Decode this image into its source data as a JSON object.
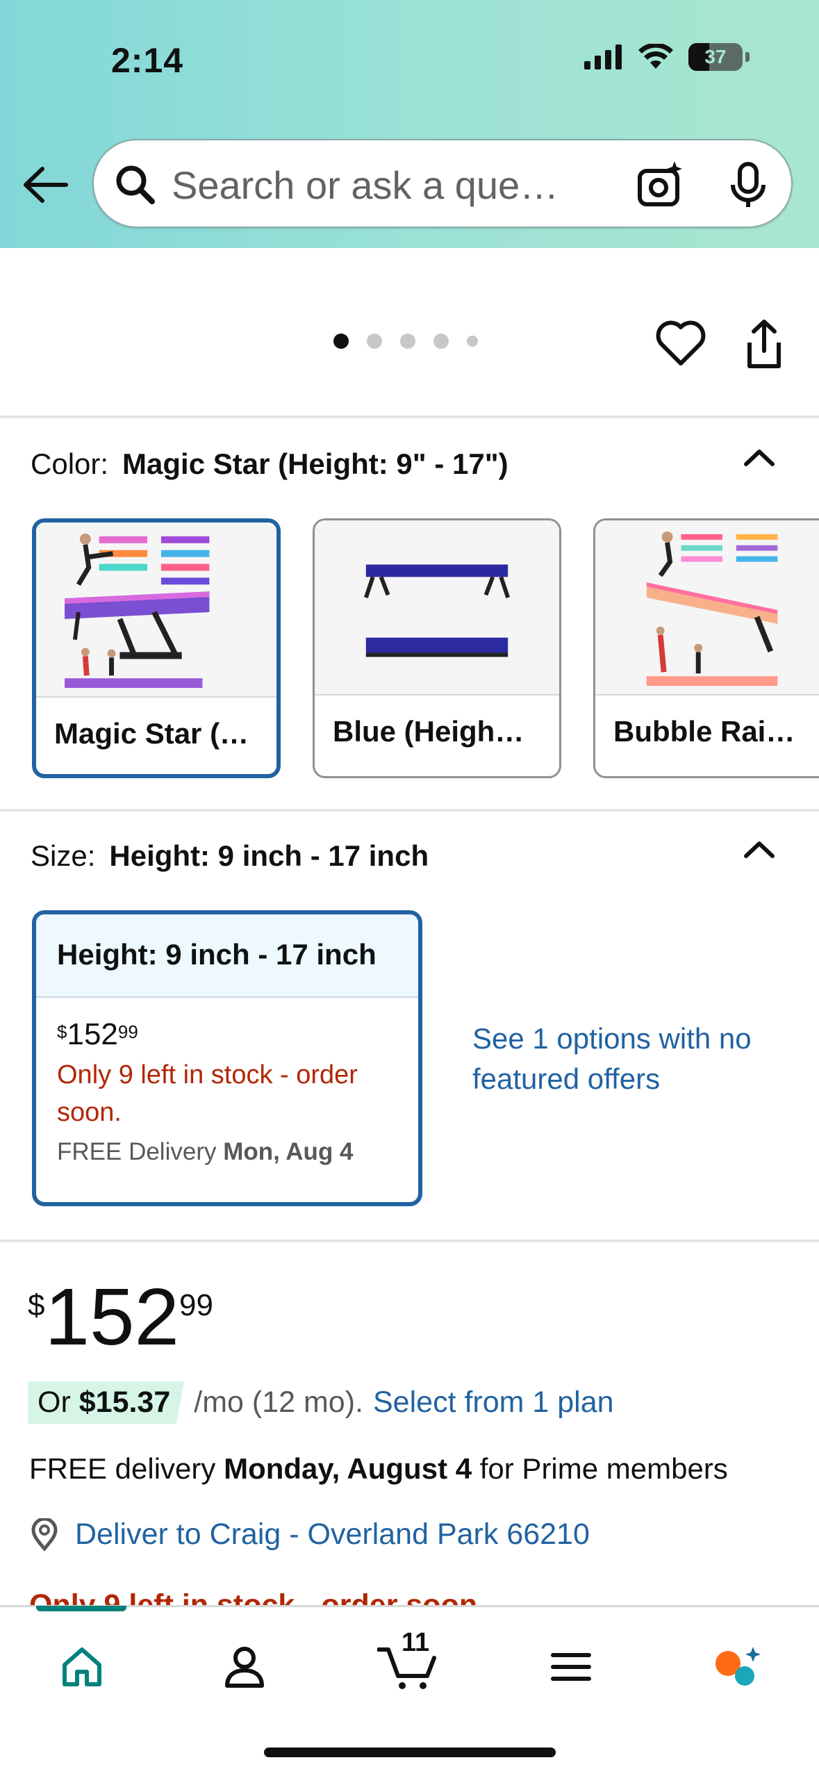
{
  "status_bar": {
    "time": "2:14",
    "battery": "37"
  },
  "search": {
    "placeholder": "Search or ask a que…"
  },
  "gallery": {
    "dot_count": 5,
    "active_index": 0
  },
  "color_section": {
    "label": "Color:",
    "selected_value": "Magic Star (Height: 9\" - 17\")",
    "options": [
      {
        "label": "Magic Star (…",
        "selected": true
      },
      {
        "label": "Blue (Heigh…",
        "selected": false
      },
      {
        "label": "Bubble Rai…",
        "selected": false
      }
    ]
  },
  "size_section": {
    "label": "Size:",
    "selected_value": "Height: 9 inch - 17 inch",
    "card": {
      "title": "Height: 9 inch - 17 inch",
      "price_currency": "$",
      "price_whole": "152",
      "price_fraction": "99",
      "stock": "Only 9 left in stock - order soon.",
      "delivery_prefix": "FREE Delivery",
      "delivery_date": "Mon, Aug 4"
    },
    "see_options_link": "See 1 options with no featured offers"
  },
  "price": {
    "currency": "$",
    "whole": "152",
    "fraction": "99"
  },
  "monthly": {
    "or_label": "Or",
    "amount": "$15.37",
    "term": "/mo (12 mo).",
    "plan_link": "Select from 1 plan"
  },
  "delivery": {
    "prefix": "FREE delivery",
    "date": "Monday, August 4",
    "suffix": "for Prime members"
  },
  "deliver_to": "Deliver to Craig - Overland Park 66210",
  "stock_partial": "Only 9 left in stock - order soon.",
  "bottom_nav": {
    "cart_count": "11"
  },
  "colors": {
    "accent": "#2162a1",
    "stock_red": "#b12704",
    "nav_active": "#00827b"
  }
}
